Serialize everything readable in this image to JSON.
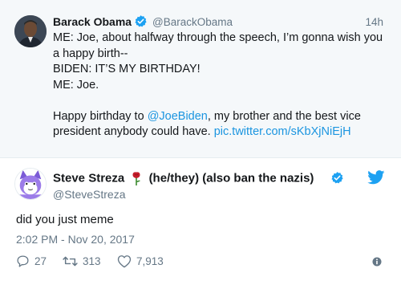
{
  "quoted_tweet": {
    "author_name": "Barack Obama",
    "handle": "@BarackObama",
    "time": "14h",
    "lines": [
      "ME: Joe, about halfway through the speech, I’m gonna wish you",
      "a happy birth--",
      "BIDEN: IT’S MY BIRTHDAY!",
      "ME: Joe."
    ],
    "line5_prefix": "Happy birthday to ",
    "mention": "@JoeBiden",
    "line5_suffix": ", my brother and the best vice",
    "line6_prefix": "president anybody could have. ",
    "pic_link": "pic.twitter.com/sKbXjNiEjH"
  },
  "tweet": {
    "author_name": "Steve Streza",
    "name_suffix": "(he/they) (also ban the nazis)",
    "handle": "@SteveStreza",
    "text": "did you just meme",
    "timestamp": "2:02 PM - Nov 20, 2017",
    "replies": "27",
    "retweets": "313",
    "likes": "7,913"
  },
  "icons": {
    "verified": "verified-badge-icon",
    "rose": "rose-emoji-icon",
    "brand": "twitter-bird-icon",
    "reply": "reply-icon",
    "retweet": "retweet-icon",
    "like": "heart-icon",
    "info": "info-icon"
  },
  "colors": {
    "link": "#1b95e0",
    "verified": "#1da1f2",
    "muted": "#657786",
    "quoted_background": "#f5f8fa"
  }
}
